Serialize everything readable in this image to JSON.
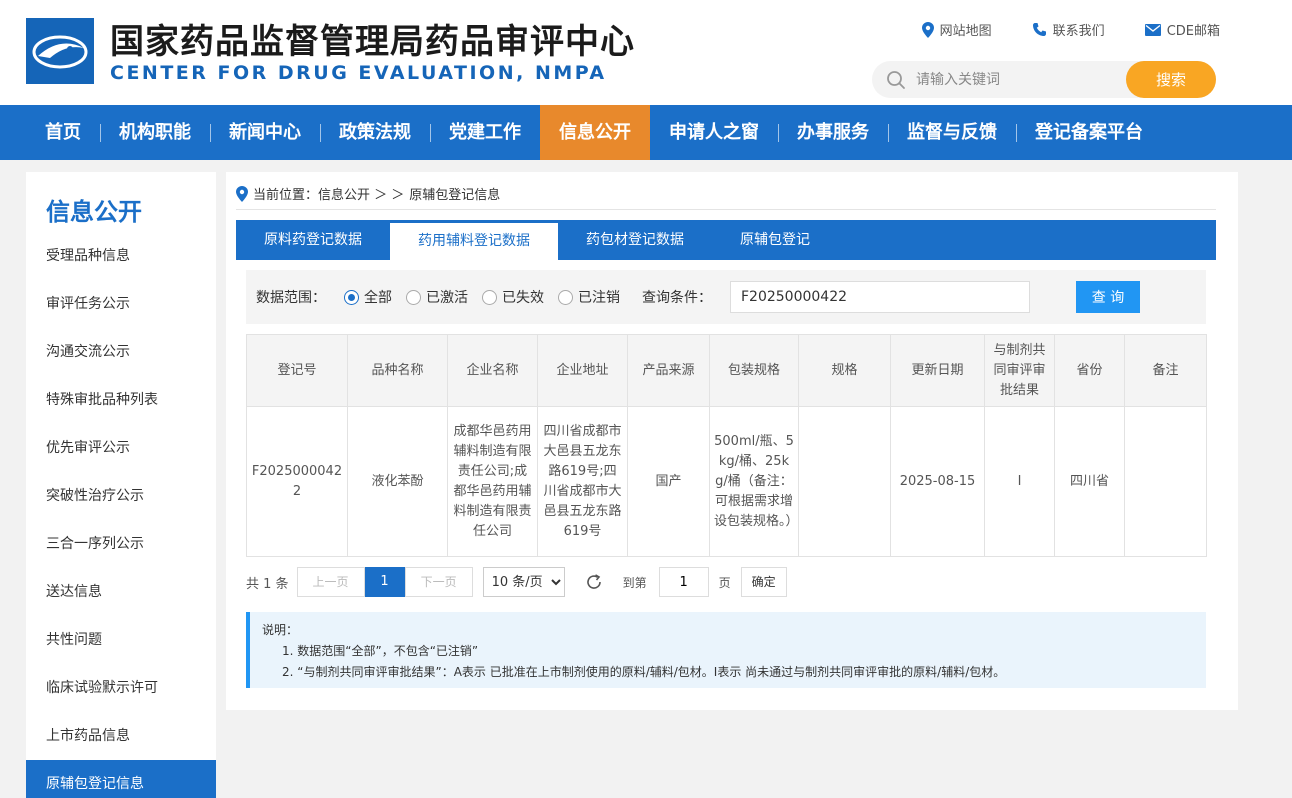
{
  "header": {
    "title_cn": "国家药品监督管理局药品审评中心",
    "title_en": "CENTER FOR DRUG EVALUATION, NMPA",
    "links": [
      {
        "label": "网站地图",
        "icon": "location-pin-icon"
      },
      {
        "label": "联系我们",
        "icon": "phone-icon"
      },
      {
        "label": "CDE邮箱",
        "icon": "mail-icon"
      }
    ],
    "search": {
      "placeholder": "请输入关键词",
      "button": "搜索"
    }
  },
  "nav": [
    "首页",
    "机构职能",
    "新闻中心",
    "政策法规",
    "党建工作",
    "信息公开",
    "申请人之窗",
    "办事服务",
    "监督与反馈",
    "登记备案平台"
  ],
  "sidebar": {
    "title": "信息公开",
    "items": [
      "受理品种信息",
      "审评任务公示",
      "沟通交流公示",
      "特殊审批品种列表",
      "优先审评公示",
      "突破性治疗公示",
      "三合一序列公示",
      "送达信息",
      "共性问题",
      "临床试验默示许可",
      "上市药品信息",
      "原辅包登记信息"
    ]
  },
  "breadcrumb": {
    "prefix": "当前位置：信息公开 ＞ ＞",
    "current": "原辅包登记信息"
  },
  "tabs": [
    "原料药登记数据",
    "药用辅料登记数据",
    "药包材登记数据",
    "原辅包登记"
  ],
  "filter": {
    "scope_label": "数据范围：",
    "options": [
      "全部",
      "已激活",
      "已失效",
      "已注销"
    ],
    "query_label": "查询条件：",
    "query_value": "F20250000422",
    "query_button": "查 询"
  },
  "table": {
    "headers": [
      "登记号",
      "品种名称",
      "企业名称",
      "企业地址",
      "产品来源",
      "包装规格",
      "规格",
      "更新日期",
      "与制剂共同审评审批结果",
      "省份",
      "备注"
    ],
    "rows": [
      [
        "F20250000422",
        "液化苯酚",
        "成都华邑药用辅料制造有限责任公司;成都华邑药用辅料制造有限责任公司",
        "四川省成都市大邑县五龙东路619号;四川省成都市大邑县五龙东路619号",
        "国产",
        "500ml/瓶、5kg/桶、25kg/桶（备注：可根据需求增设包装规格。）",
        "",
        "2025-08-15",
        "I",
        "四川省",
        ""
      ]
    ]
  },
  "pager": {
    "total": "共 1 条",
    "prev": "上一页",
    "current": "1",
    "next": "下一页",
    "page_size": "10 条/页",
    "goto_label": "到第",
    "goto_value": "1",
    "page_unit": "页",
    "confirm": "确定"
  },
  "notes": {
    "title": "说明：",
    "lines": [
      "1. 数据范围“全部”，不包含“已注销”",
      "2. “与制剂共同审评审批结果”：A表示 已批准在上市制剂使用的原料/辅料/包材。I表示 尚未通过与制剂共同审评审批的原料/辅料/包材。"
    ]
  },
  "colors": {
    "primary": "#1b6fc8",
    "active_nav": "#e8892c",
    "search_button": "#f9a623",
    "query_button": "#2196f3"
  }
}
